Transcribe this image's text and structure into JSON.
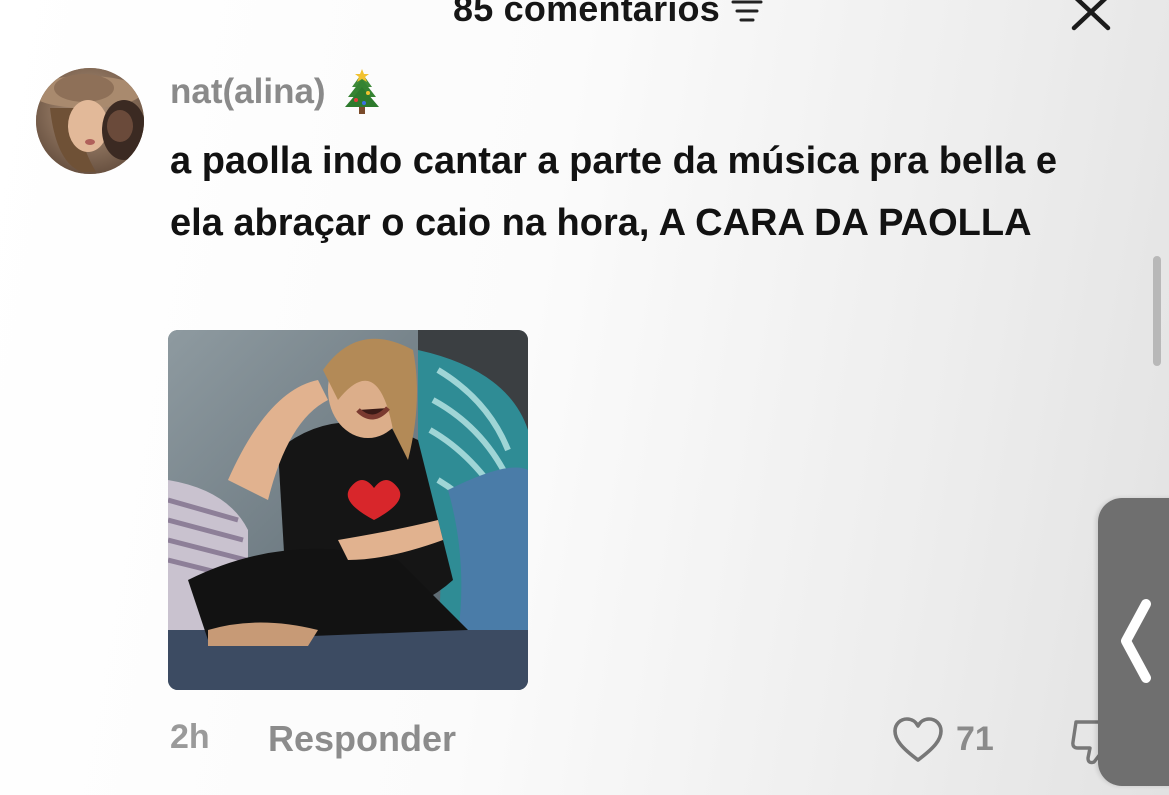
{
  "header": {
    "title": "85 comentários",
    "filter_icon": "filter-icon",
    "close_icon": "close-icon"
  },
  "comment": {
    "username": "nat(alina)",
    "username_emoji_icon": "christmas-tree-icon",
    "text": "a paolla indo cantar a parte da música pra bella e ela abraçar o caio na hora, A CARA DA PAOLLA",
    "time": "2h",
    "reply_label": "Responder",
    "like_count": "71",
    "like_icon": "heart-icon",
    "dislike_icon": "thumbs-down-icon"
  },
  "side_panel": {
    "chevron_icon": "chevron-left-icon"
  },
  "colors": {
    "text_primary": "#121212",
    "text_muted": "#8a8a8a",
    "handle": "#6f6f6f"
  }
}
